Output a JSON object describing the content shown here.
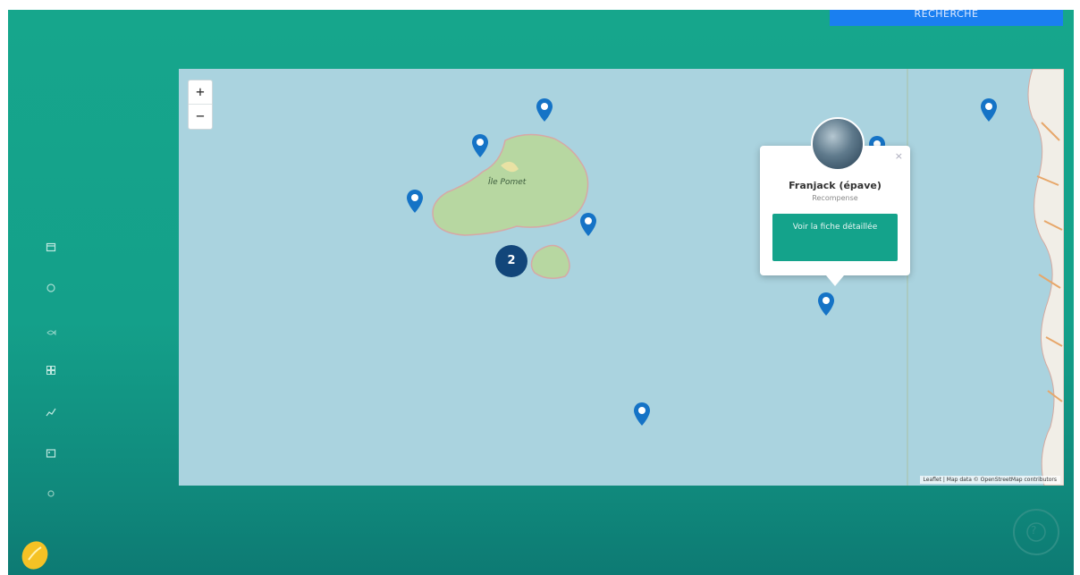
{
  "header": {
    "search_button_label": "RECHERCHE"
  },
  "sidebar": {
    "icons": [
      "calendar-icon",
      "circle-icon",
      "fish-icon",
      "grid-icon",
      "chart-icon",
      "image-icon",
      "settings-icon"
    ]
  },
  "map": {
    "zoom_in_label": "+",
    "zoom_out_label": "−",
    "island_label": "Île Pomet",
    "cluster_count": "2",
    "attribution": "Leaflet | Map data © OpenStreetMap contributors",
    "popup": {
      "close": "×",
      "title": "Franjack (épave)",
      "subtitle": "Recompense",
      "button_label": "Voir la fiche détaillée"
    }
  },
  "footer": {
    "help_label": "?"
  },
  "colors": {
    "accent": "#14a38b",
    "marker": "#1573c6",
    "cluster": "#12467a",
    "search": "#1a7ff0"
  }
}
